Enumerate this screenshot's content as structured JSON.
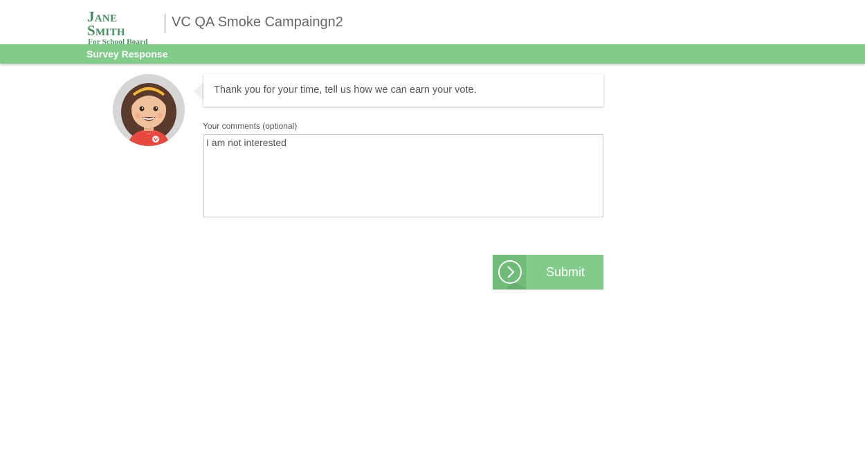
{
  "header": {
    "logo_line1": "Jane Smith",
    "logo_line2": "For School Board",
    "campaign_title": "VC QA Smoke Campaingn2"
  },
  "subbar": {
    "title": "Survey Response"
  },
  "question": {
    "text": "Thank you for your time, tell us how we can earn your vote."
  },
  "comments": {
    "label": "Your comments (optional)",
    "value": "I am not interested"
  },
  "submit": {
    "label": "Submit",
    "icon": "chevron-right-icon"
  },
  "colors": {
    "accent": "#80cc88",
    "brand": "#3f8f5a"
  }
}
